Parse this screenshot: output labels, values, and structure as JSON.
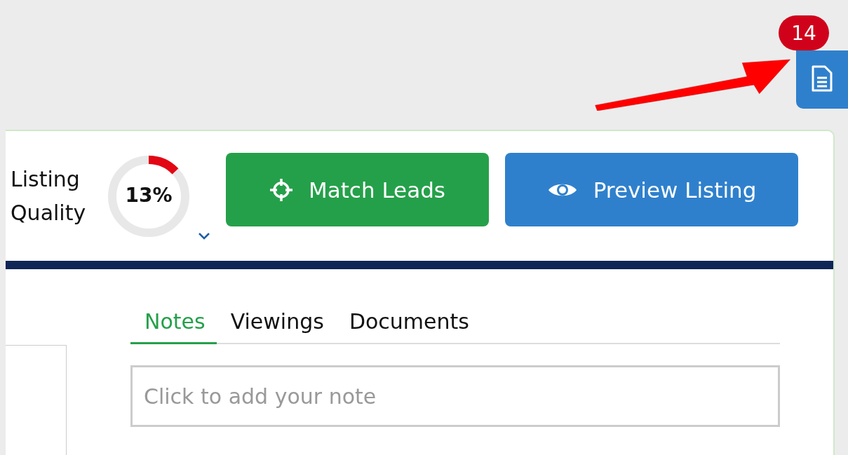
{
  "documents_button": {
    "badge": "14"
  },
  "quality": {
    "label": "Listing Quality",
    "reading": "13%",
    "level": 0.13
  },
  "actions": [
    {
      "label": "Match Leads",
      "kind": "match"
    },
    {
      "label": "Preview Listing",
      "kind": "preview"
    }
  ],
  "tabs": [
    {
      "label": "Notes",
      "selected": true
    },
    {
      "label": "Viewings",
      "selected": false
    },
    {
      "label": "Documents",
      "selected": false
    }
  ],
  "note": {
    "placeholder": "Click to add your note"
  }
}
